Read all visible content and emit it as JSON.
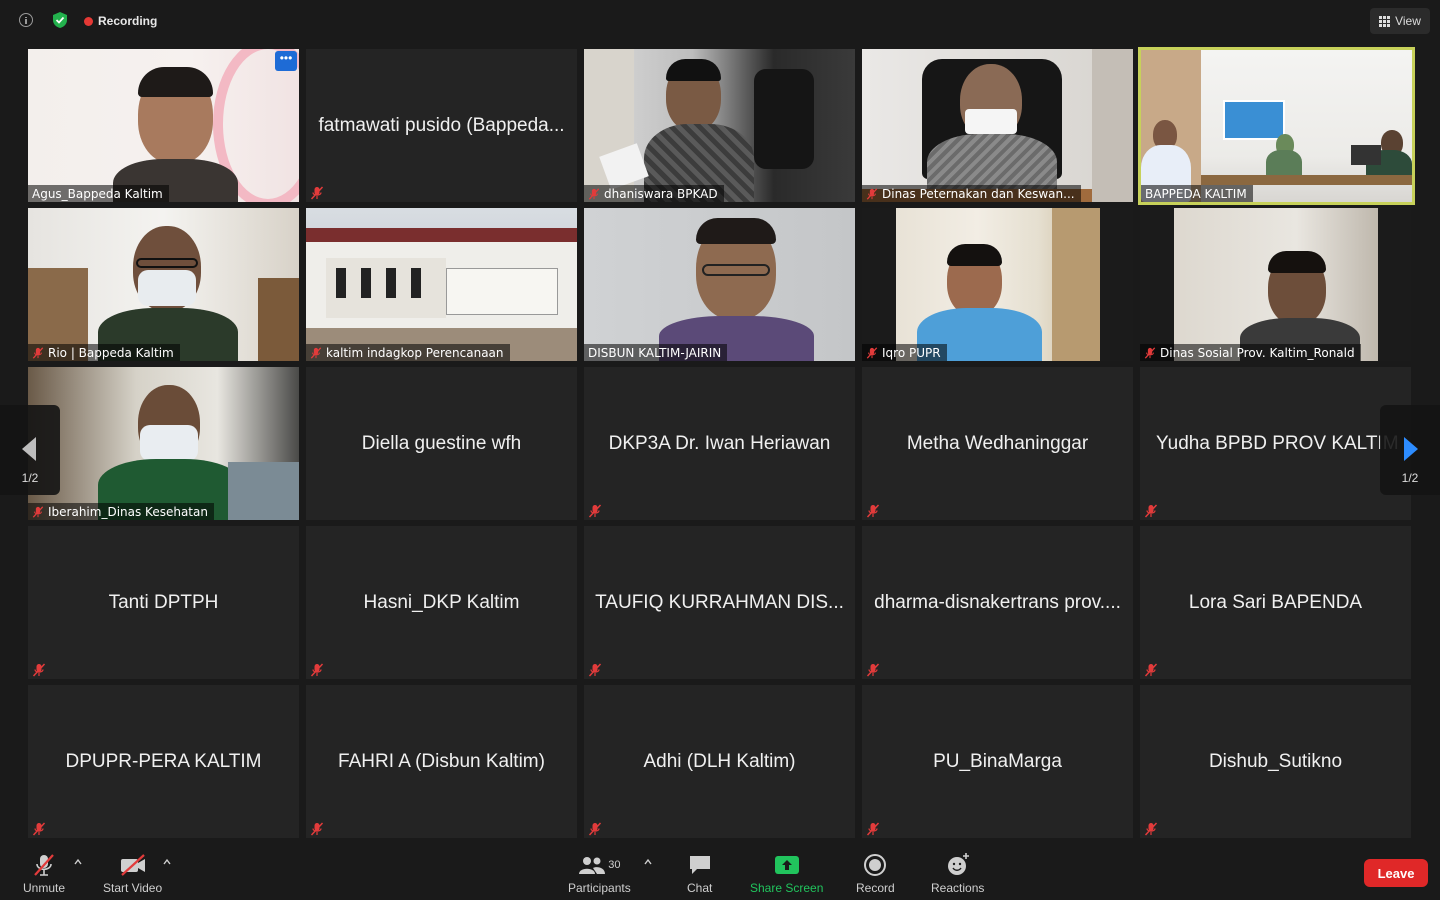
{
  "topbar": {
    "recording_label": "Recording",
    "view_label": "View"
  },
  "tiles": [
    {
      "name": "Agus_Bappeda Kaltim"
    },
    {
      "name": "fatmawati pusido (Bappeda..."
    },
    {
      "name": "dhaniswara BPKAD"
    },
    {
      "name": "Dinas Peternakan dan Keswan..."
    },
    {
      "name": "BAPPEDA KALTIM"
    },
    {
      "name": "Rio | Bappeda Kaltim"
    },
    {
      "name": "kaltim indagkop Perencanaan"
    },
    {
      "name": "DISBUN KALTIM-JAIRIN"
    },
    {
      "name": "Iqro PUPR"
    },
    {
      "name": "Dinas Sosial Prov. Kaltim_Ronald"
    },
    {
      "name": "Iberahim_Dinas Kesehatan"
    },
    {
      "name": "Diella guestine wfh"
    },
    {
      "name": "DKP3A Dr. Iwan Heriawan"
    },
    {
      "name": "Metha Wedhaninggar"
    },
    {
      "name": "Yudha BPBD PROV KALTIM"
    },
    {
      "name": "Tanti DPTPH"
    },
    {
      "name": "Hasni_DKP Kaltim"
    },
    {
      "name": "TAUFIQ KURRAHMAN DIS..."
    },
    {
      "name": "dharma-disnakertrans prov...."
    },
    {
      "name": "Lora Sari BAPENDA"
    },
    {
      "name": "DPUPR-PERA KALTIM"
    },
    {
      "name": "FAHRI A (Disbun Kaltim)"
    },
    {
      "name": "Adhi (DLH Kaltim)"
    },
    {
      "name": "PU_BinaMarga"
    },
    {
      "name": "Dishub_Sutikno"
    }
  ],
  "pagination": {
    "left": "1/2",
    "right": "1/2"
  },
  "toolbar": {
    "unmute": "Unmute",
    "start_video": "Start Video",
    "participants": "Participants",
    "participant_count": "30",
    "chat": "Chat",
    "share_screen": "Share Screen",
    "record": "Record",
    "reactions": "Reactions",
    "leave": "Leave"
  },
  "colors": {
    "leave": "#e02828",
    "share": "#21c45d",
    "active_speaker": "#c7d15a",
    "nav_arrow": "#2d8cff"
  }
}
